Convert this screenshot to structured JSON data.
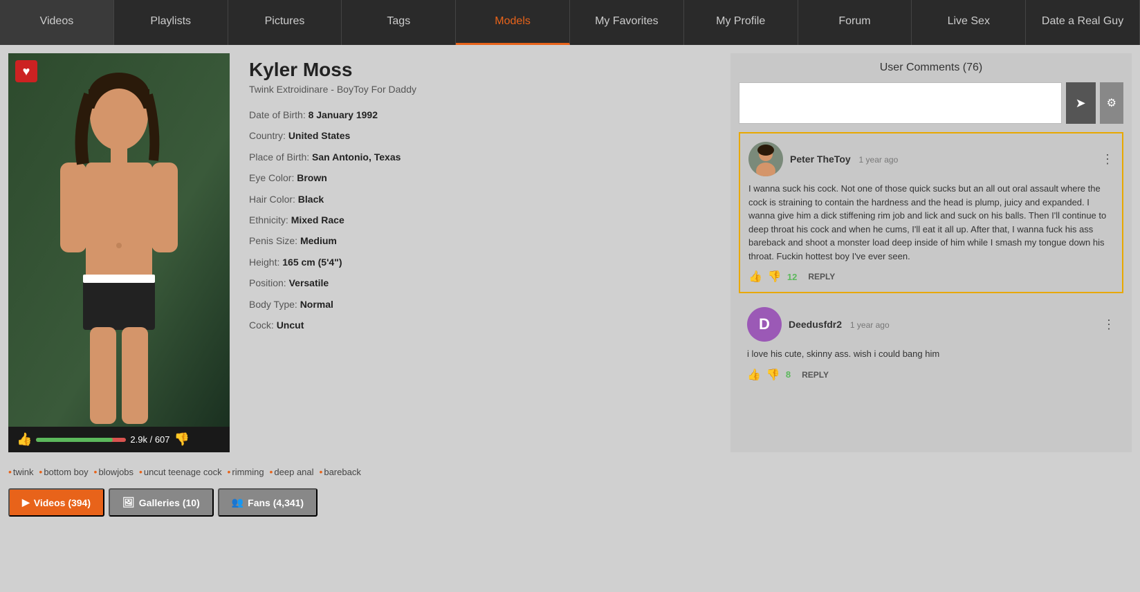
{
  "nav": {
    "items": [
      {
        "label": "Videos",
        "active": false
      },
      {
        "label": "Playlists",
        "active": false
      },
      {
        "label": "Pictures",
        "active": false
      },
      {
        "label": "Tags",
        "active": false
      },
      {
        "label": "Models",
        "active": true
      },
      {
        "label": "My Favorites",
        "active": false
      },
      {
        "label": "My Profile",
        "active": false
      },
      {
        "label": "Forum",
        "active": false
      },
      {
        "label": "Live Sex",
        "active": false
      },
      {
        "label": "Date a Real Guy",
        "active": false
      }
    ]
  },
  "model": {
    "name": "Kyler Moss",
    "subtitle": "Twink Extroidinare - BoyToy For Daddy",
    "dob_label": "Date of Birth:",
    "dob_value": "8 January 1992",
    "country_label": "Country:",
    "country_value": "United States",
    "pob_label": "Place of Birth:",
    "pob_value": "San Antonio, Texas",
    "eye_label": "Eye Color:",
    "eye_value": "Brown",
    "hair_label": "Hair Color:",
    "hair_value": "Black",
    "ethnicity_label": "Ethnicity:",
    "ethnicity_value": "Mixed Race",
    "penis_label": "Penis Size:",
    "penis_value": "Medium",
    "height_label": "Height:",
    "height_value": "165 cm (5'4\")",
    "position_label": "Position:",
    "position_value": "Versatile",
    "body_label": "Body Type:",
    "body_value": "Normal",
    "cock_label": "Cock:",
    "cock_value": "Uncut",
    "rating": "2.9k / 607",
    "rating_fill_pct": 85
  },
  "tags": [
    "twink",
    "bottom boy",
    "blowjobs",
    "uncut teenage cock",
    "rimming",
    "deep anal",
    "bareback"
  ],
  "bottom_tabs": [
    {
      "icon": "▶",
      "label": "Videos (394)",
      "style": "orange"
    },
    {
      "icon": "🖼",
      "label": "Galleries (10)",
      "style": "gray"
    },
    {
      "icon": "👥",
      "label": "Fans (4,341)",
      "style": "gray"
    }
  ],
  "comments": {
    "title": "User Comments (76)",
    "input_placeholder": "",
    "send_label": "➤",
    "settings_label": "⚙",
    "items": [
      {
        "id": 1,
        "username": "Peter TheToy",
        "time": "1 year ago",
        "avatar_type": "image",
        "avatar_color": "#888",
        "avatar_initial": "P",
        "body": "I wanna suck his cock. Not one of those quick sucks but an all out oral assault where the cock is straining to contain the hardness and the head is plump, juicy and expanded. I wanna give him a dick stiffening rim job and lick and suck on his balls. Then I'll continue to deep throat his cock and when he cums, I'll eat it all up. After that, I wanna fuck his ass bareback and shoot a monster load deep inside of him while I smash my tongue down his throat. Fuckin hottest boy I've ever seen.",
        "likes": 12,
        "highlighted": true
      },
      {
        "id": 2,
        "username": "Deedusfdr2",
        "time": "1 year ago",
        "avatar_type": "initial",
        "avatar_color": "#9b59b6",
        "avatar_initial": "D",
        "body": "i love his cute, skinny ass. wish i could bang him",
        "likes": 8,
        "highlighted": false
      }
    ]
  }
}
